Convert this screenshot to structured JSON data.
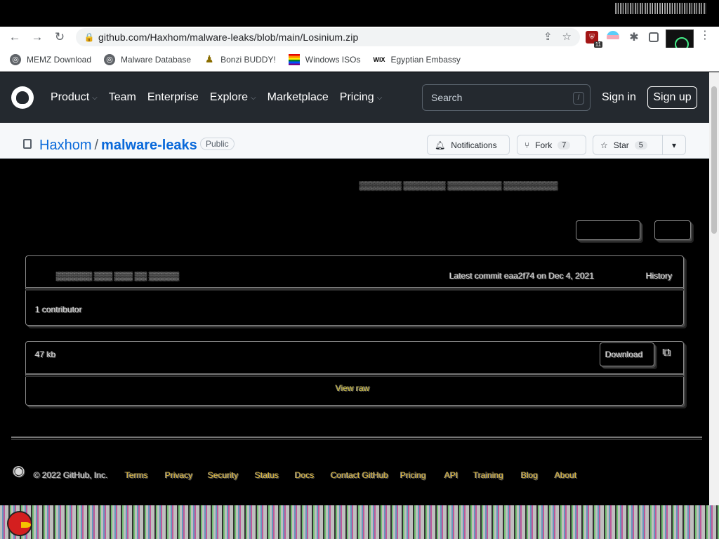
{
  "browser": {
    "url": "github.com/Haxhom/malware-leaks/blob/main/Losinium.zip",
    "extension_badge": "11"
  },
  "bookmarks": [
    {
      "label": "MEMZ Download",
      "icon": "globe-icon"
    },
    {
      "label": "Malware Database",
      "icon": "globe-icon"
    },
    {
      "label": "Bonzi BUDDY!",
      "icon": "bonzi-icon"
    },
    {
      "label": "Windows ISOs",
      "icon": "rainbow-flag-icon"
    },
    {
      "label": "Egyptian Embassy",
      "icon": "wix-icon"
    }
  ],
  "github": {
    "nav": [
      {
        "label": "Product",
        "dropdown": true
      },
      {
        "label": "Team",
        "dropdown": false
      },
      {
        "label": "Enterprise",
        "dropdown": false
      },
      {
        "label": "Explore",
        "dropdown": true
      },
      {
        "label": "Marketplace",
        "dropdown": false
      },
      {
        "label": "Pricing",
        "dropdown": true
      }
    ],
    "search_placeholder": "Search",
    "search_key": "/",
    "sign_in": "Sign in",
    "sign_up": "Sign up"
  },
  "repo": {
    "owner": "Haxhom",
    "separator": "/",
    "name": "malware-leaks",
    "visibility": "Public",
    "notifications_label": "Notifications",
    "fork_label": "Fork",
    "fork_count": "7",
    "star_label": "Star",
    "star_count": "5"
  },
  "glitched": {
    "commit_line": "Latest commit eaa2f74 on Dec 4, 2021",
    "history": "History",
    "contributors": "1 contributor",
    "file_size": "47 kb",
    "download": "Download",
    "view_raw": "View raw",
    "footer": [
      "© 2022 GitHub, Inc.",
      "Terms",
      "Privacy",
      "Security",
      "Status",
      "Docs",
      "Contact GitHub",
      "Pricing",
      "API",
      "Training",
      "Blog",
      "About"
    ]
  },
  "colors": {
    "github_header": "#24292f",
    "link_blue": "#0969da"
  }
}
